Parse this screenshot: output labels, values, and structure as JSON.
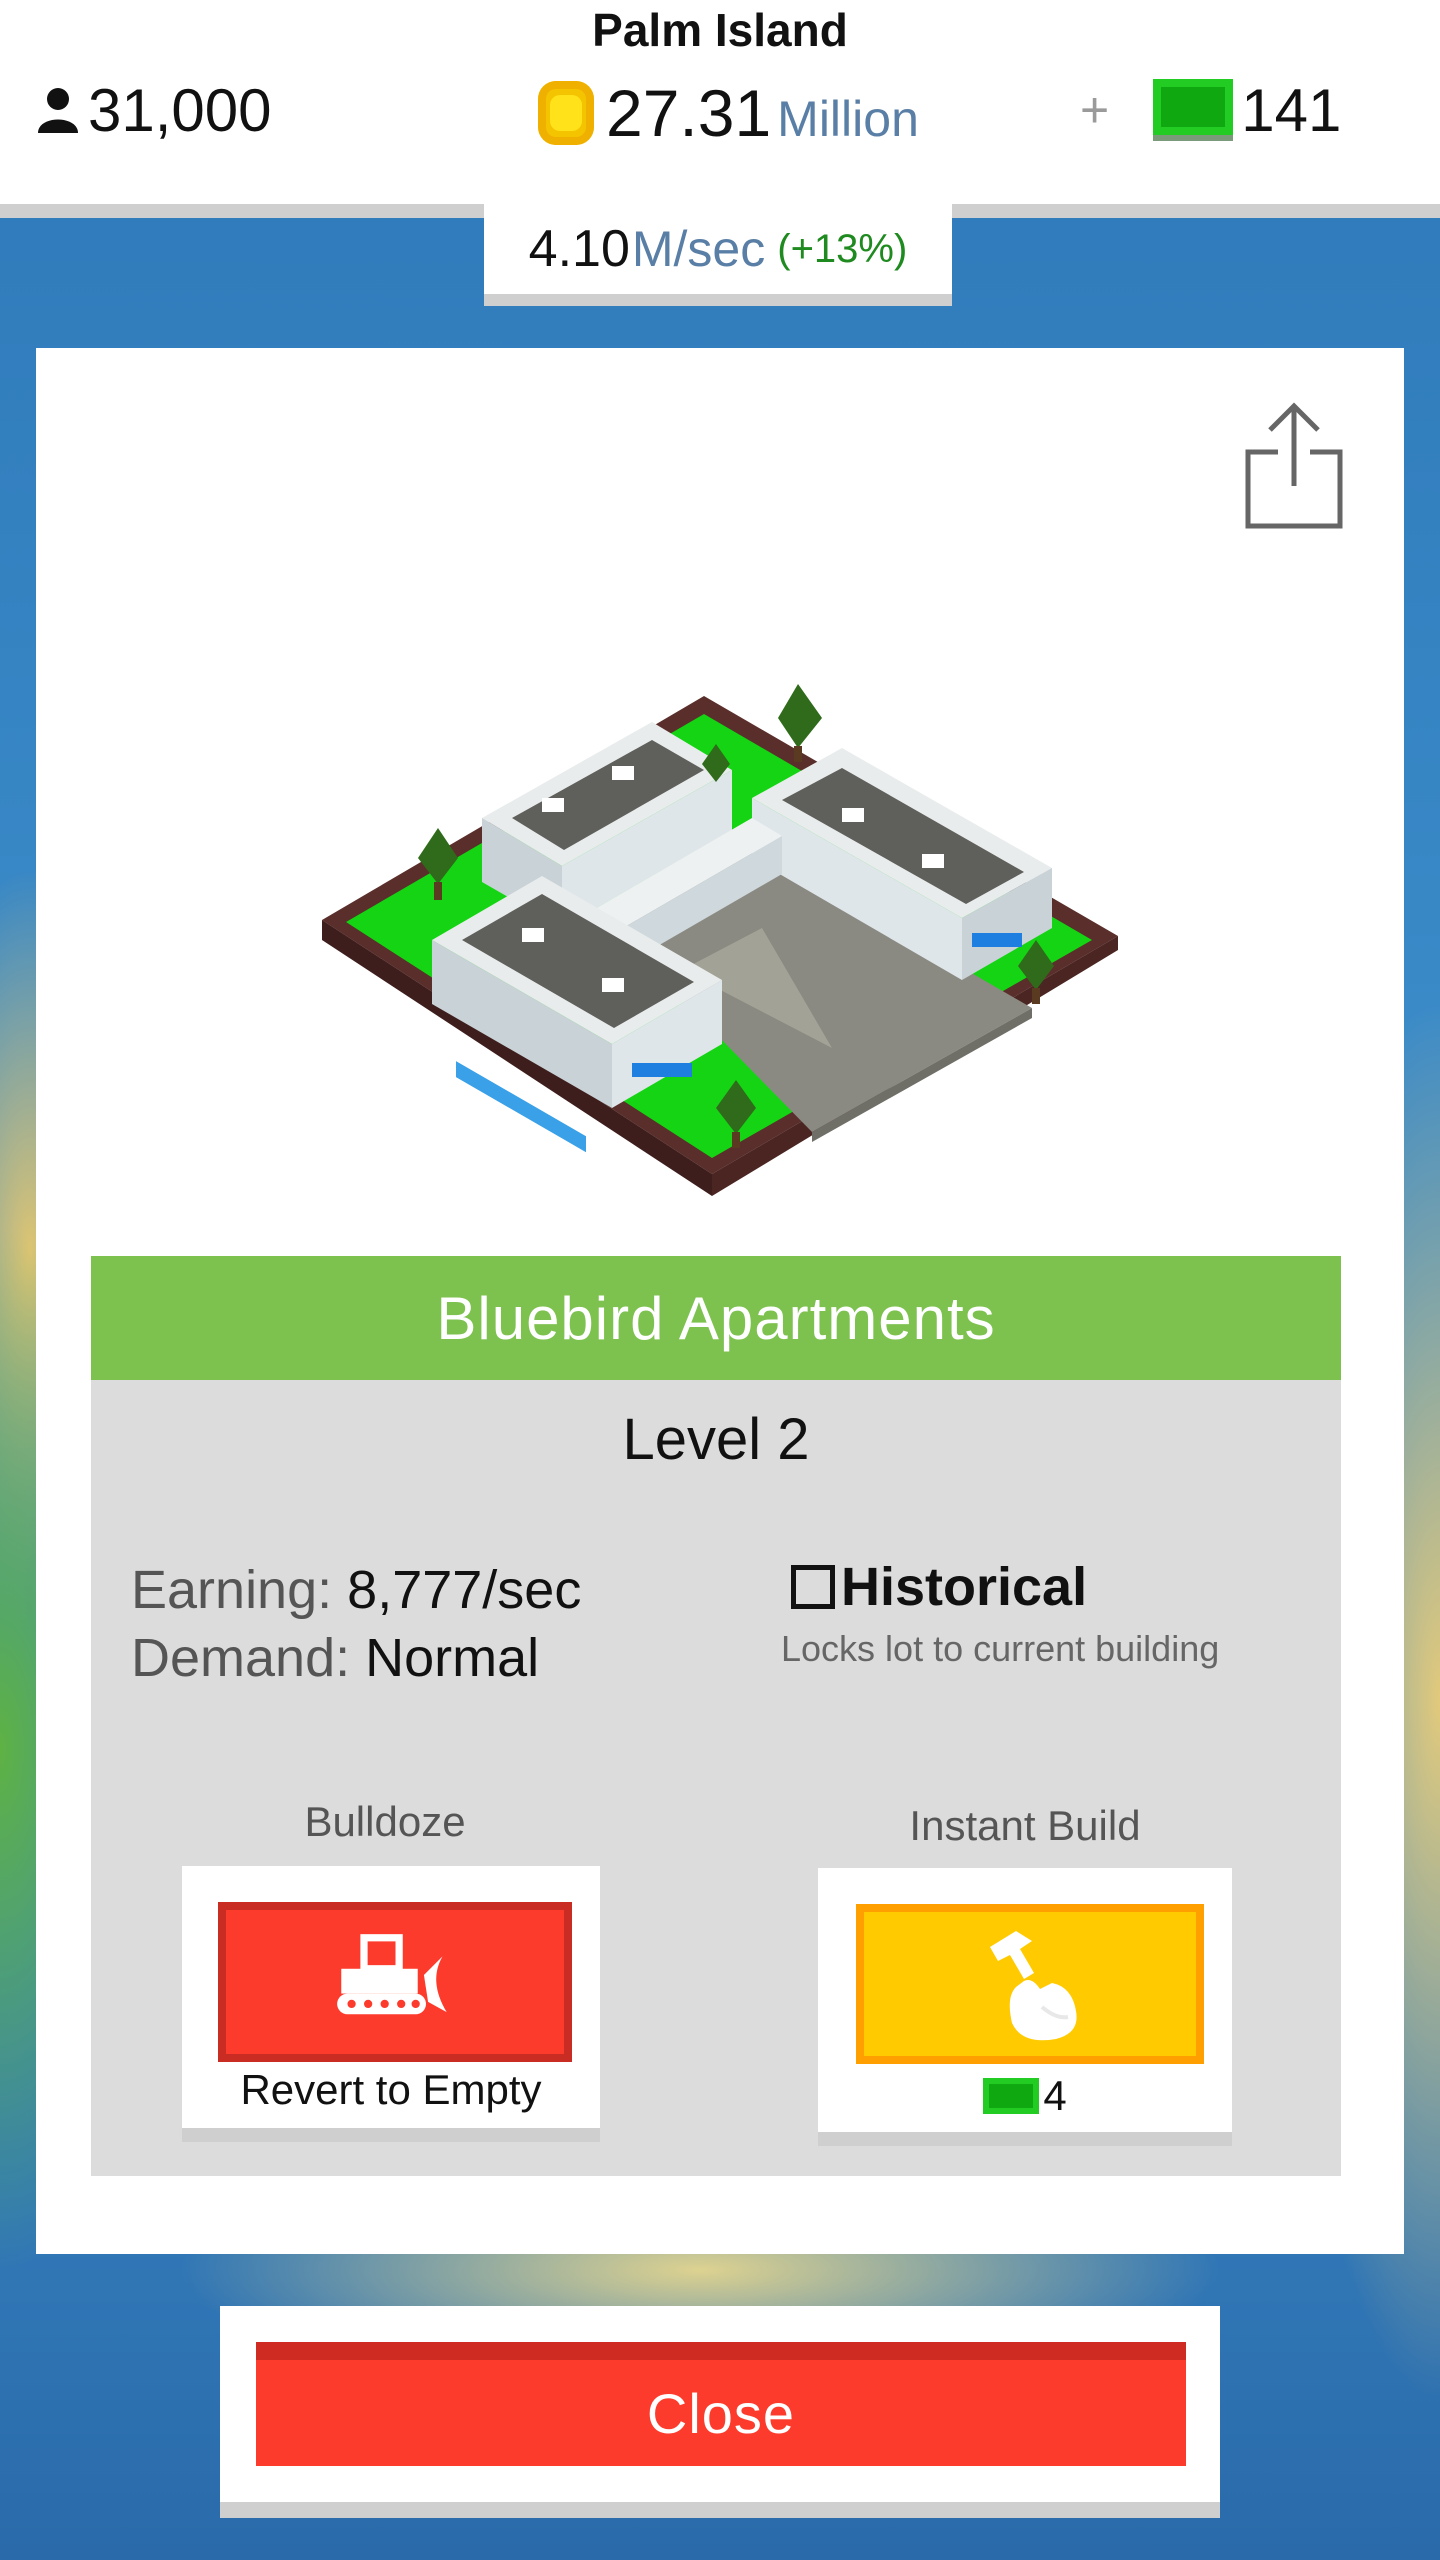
{
  "header": {
    "island_name": "Palm Island",
    "population": "31,000",
    "money_value": "27.31",
    "money_unit": "Million",
    "plus": "+",
    "cash": "141"
  },
  "rate": {
    "value": "4.10",
    "unit": "M/sec",
    "change": "(+13%)"
  },
  "building": {
    "name": "Bluebird Apartments",
    "level": "Level 2",
    "earning_label": "Earning:",
    "earning_value": "8,777/sec",
    "demand_label": "Demand:",
    "demand_value": "Normal",
    "historical_label": "Historical",
    "historical_desc": "Locks lot to current building",
    "historical_checked": false
  },
  "actions": {
    "bulldoze_label": "Bulldoze",
    "bulldoze_caption": "Revert to Empty",
    "instant_build_label": "Instant Build",
    "instant_build_cost": "4"
  },
  "close_label": "Close",
  "icons": {
    "population": "person-icon",
    "money": "coin-icon",
    "cash": "cash-bill-icon",
    "share": "share-icon",
    "bulldoze": "bulldozer-icon",
    "instant_build": "hammer-hand-icon"
  },
  "colors": {
    "header_green": "#7dc14f",
    "danger_red": "#fd3b2c",
    "instant_yellow": "#ffcb00",
    "rate_green": "#1f8a1f",
    "unit_blue": "#5a7fa6"
  }
}
